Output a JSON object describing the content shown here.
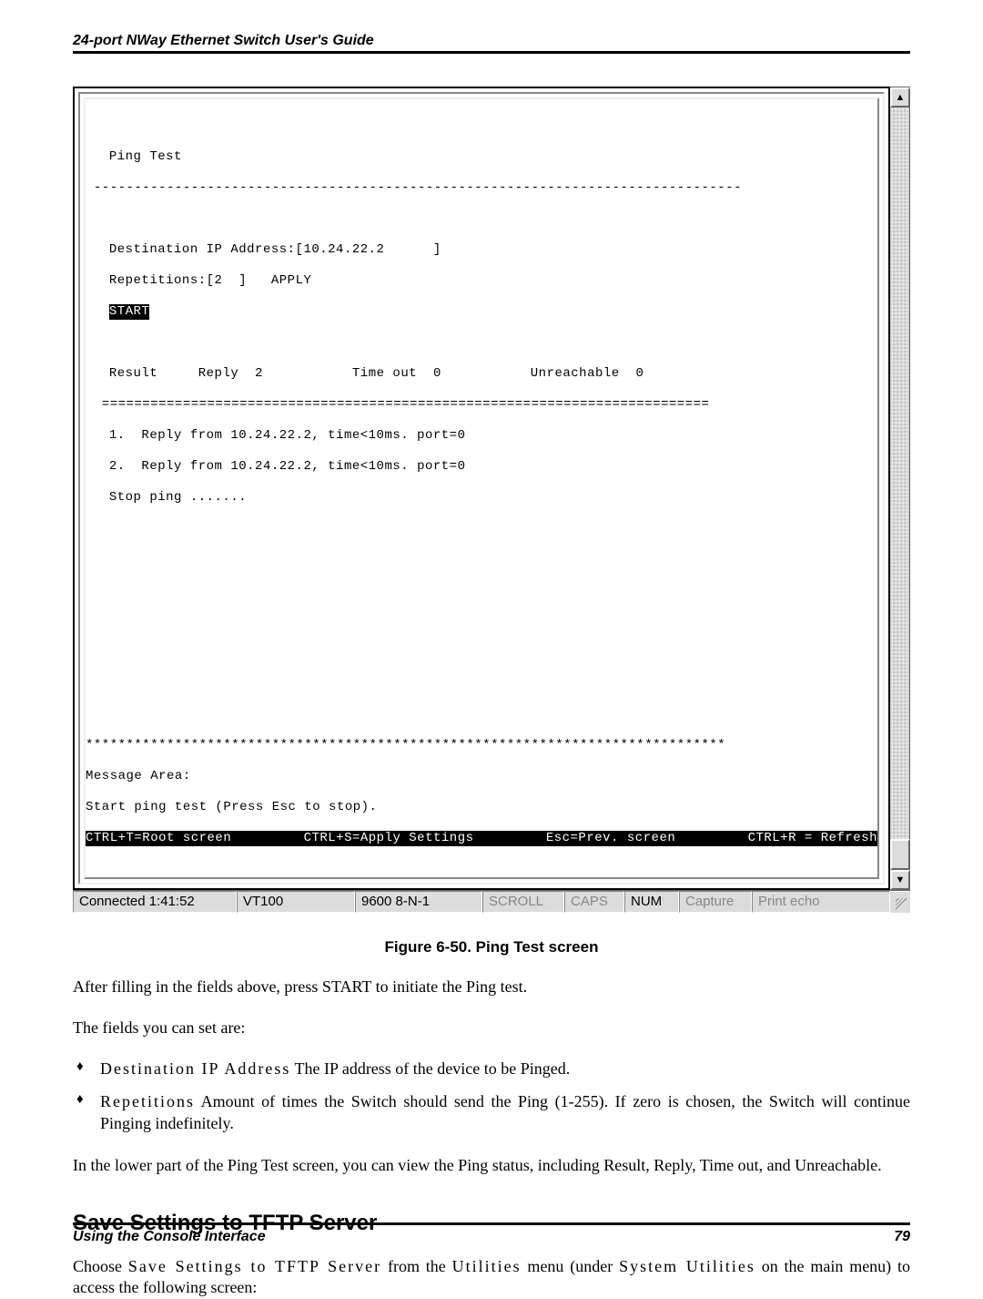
{
  "header": {
    "title": "24-port NWay Ethernet Switch User's Guide"
  },
  "terminal": {
    "title": "Ping Test",
    "divider1": " --------------------------------------------------------------------------------",
    "fields": {
      "dest_label": "Destination IP Address:",
      "dest_value": "[10.24.22.2      ]",
      "reps_label": "Repetitions:",
      "reps_value": "[2  ]",
      "apply": "APPLY",
      "start": "START"
    },
    "results_header": {
      "result": "Result",
      "reply_lbl": "Reply",
      "reply_val": "2",
      "timeout_lbl": "Time out",
      "timeout_val": "0",
      "unreach_lbl": "Unreachable",
      "unreach_val": "0"
    },
    "divider2": "  ===========================================================================",
    "results": [
      "1.  Reply from 10.24.22.2, time<10ms. port=0",
      "2.  Reply from 10.24.22.2, time<10ms. port=0",
      "Stop ping ......."
    ],
    "stars": "*******************************************************************************",
    "msg_area": "Message Area:",
    "msg_text": "Start ping test (Press Esc to stop).",
    "footer": {
      "c1": "CTRL+T=Root screen",
      "c2": "CTRL+S=Apply Settings",
      "c3": "Esc=Prev. screen",
      "c4": "CTRL+R = Refresh"
    }
  },
  "statusbar": {
    "conn": "Connected 1:41:52",
    "term": "VT100",
    "baud": "9600 8-N-1",
    "s1": "SCROLL",
    "s2": "CAPS",
    "s3": "NUM",
    "s4": "Capture",
    "s5": "Print echo"
  },
  "figure_caption": "Figure 6-50.  Ping Test screen",
  "para1": "After filling in the fields above, press START to initiate the Ping test.",
  "para2": "The fields you can set are:",
  "bullets": [
    {
      "term": "Destination IP Address",
      "desc": "  The IP address of the device to be Pinged."
    },
    {
      "term": "Repetitions",
      "desc": "  Amount of times the Switch should send the Ping (1-255). If zero is chosen, the Switch will continue Pinging indefinitely."
    }
  ],
  "para3": "In the lower part of the Ping Test screen, you can view the Ping status, including Result, Reply, Time out, and Unreachable.",
  "section_heading": "Save Settings to TFTP Server",
  "para4_a": "Choose ",
  "para4_term1": "Save Settings to TFTP Server",
  "para4_b": " from the ",
  "para4_term2": "Utilities",
  "para4_c": " menu (under ",
  "para4_term3": "System Utilities",
  "para4_d": " on the main menu) to access the following screen:",
  "footer": {
    "left": "Using the Console Interface",
    "right": "79"
  }
}
